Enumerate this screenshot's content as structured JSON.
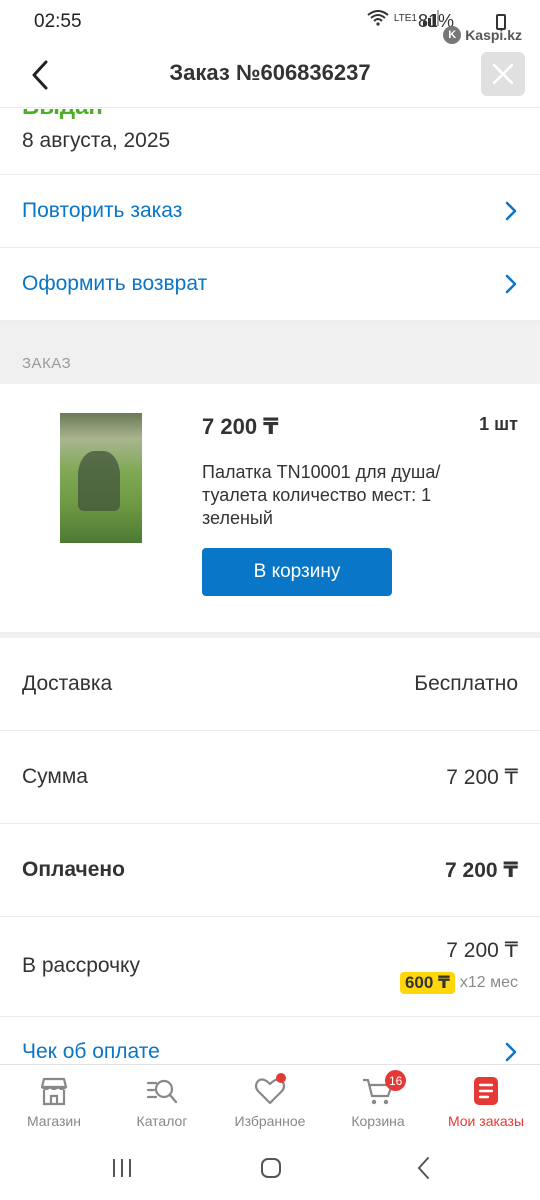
{
  "status_bar": {
    "time": "02:55",
    "battery": "81%",
    "network": "LTE1",
    "brand": "Kaspi.kz"
  },
  "header": {
    "title": "Заказ №606836237"
  },
  "order_status": {
    "status": "Выдан",
    "date": "8 августа, 2025"
  },
  "actions": {
    "repeat_label": "Повторить заказ",
    "return_label": "Оформить возврат"
  },
  "order_section": {
    "label": "ЗАКАЗ",
    "item": {
      "price": "7 200 ₸",
      "quantity": "1 шт",
      "name": "Палатка TN10001 для душа/туалета количество мест: 1 зеленый",
      "cart_button": "В корзину"
    }
  },
  "summary": {
    "delivery_label": "Доставка",
    "delivery_value": "Бесплатно",
    "sum_label": "Сумма",
    "sum_value": "7 200 ₸",
    "paid_label": "Оплачено",
    "paid_value": "7 200 ₸",
    "installment_label": "В рассрочку",
    "installment_value": "7 200 ₸",
    "installment_monthly": "600 ₸",
    "installment_term": "х12 мес",
    "receipt_label": "Чек об оплате"
  },
  "tabs": [
    {
      "label": "Магазин",
      "icon": "shop-icon"
    },
    {
      "label": "Каталог",
      "icon": "catalog-search-icon"
    },
    {
      "label": "Избранное",
      "icon": "heart-icon"
    },
    {
      "label": "Корзина",
      "icon": "cart-icon",
      "badge": "16"
    },
    {
      "label": "Мои заказы",
      "icon": "orders-icon",
      "active": true
    }
  ],
  "colors": {
    "accent": "#0a76c7",
    "active_tab": "#e53935",
    "status_green": "#4caf28",
    "installment_badge": "#ffd60a"
  }
}
